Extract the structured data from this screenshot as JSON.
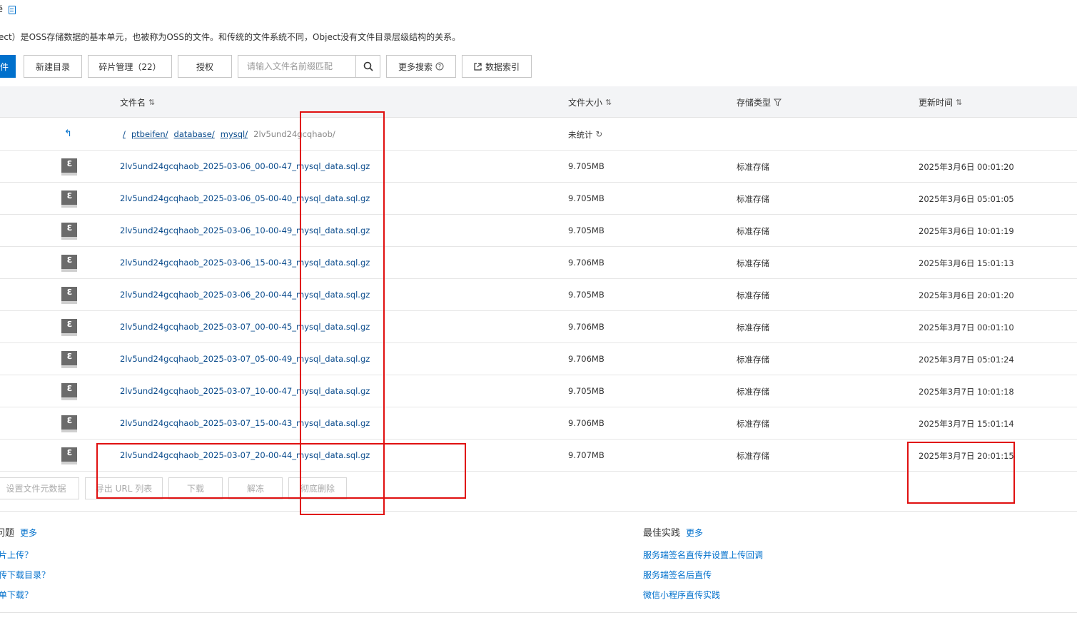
{
  "header": {
    "title": "ë",
    "description": "ect）是OSS存储数据的基本单元，也被称为OSS的文件。和传统的文件系统不同，Object没有文件目录层级结构的关系。"
  },
  "toolbar": {
    "upload_label": "件",
    "new_dir_label": "新建目录",
    "fragments_label": "碎片管理（22）",
    "authorize_label": "授权",
    "search_placeholder": "请输入文件名前缀匹配",
    "more_search_label": "更多搜索",
    "data_index_label": "数据索引"
  },
  "table": {
    "headers": {
      "name": "文件名",
      "size": "文件大小",
      "storage": "存储类型",
      "time": "更新时间"
    },
    "breadcrumb": [
      "/",
      "ptbeifen/",
      "database/",
      "mysql/"
    ],
    "breadcrumb_current": "2lv5und24gcqhaob/",
    "unstat_label": "未统计",
    "rows": [
      {
        "name": "2lv5und24gcqhaob_2025-03-06_00-00-47_mysql_data.sql.gz",
        "size": "9.705MB",
        "type": "标准存储",
        "time": "2025年3月6日 00:01:20"
      },
      {
        "name": "2lv5und24gcqhaob_2025-03-06_05-00-40_mysql_data.sql.gz",
        "size": "9.705MB",
        "type": "标准存储",
        "time": "2025年3月6日 05:01:05"
      },
      {
        "name": "2lv5und24gcqhaob_2025-03-06_10-00-49_mysql_data.sql.gz",
        "size": "9.705MB",
        "type": "标准存储",
        "time": "2025年3月6日 10:01:19"
      },
      {
        "name": "2lv5und24gcqhaob_2025-03-06_15-00-43_mysql_data.sql.gz",
        "size": "9.706MB",
        "type": "标准存储",
        "time": "2025年3月6日 15:01:13"
      },
      {
        "name": "2lv5und24gcqhaob_2025-03-06_20-00-44_mysql_data.sql.gz",
        "size": "9.705MB",
        "type": "标准存储",
        "time": "2025年3月6日 20:01:20"
      },
      {
        "name": "2lv5und24gcqhaob_2025-03-07_00-00-45_mysql_data.sql.gz",
        "size": "9.706MB",
        "type": "标准存储",
        "time": "2025年3月7日 00:01:10"
      },
      {
        "name": "2lv5und24gcqhaob_2025-03-07_05-00-49_mysql_data.sql.gz",
        "size": "9.706MB",
        "type": "标准存储",
        "time": "2025年3月7日 05:01:24"
      },
      {
        "name": "2lv5und24gcqhaob_2025-03-07_10-00-47_mysql_data.sql.gz",
        "size": "9.705MB",
        "type": "标准存储",
        "time": "2025年3月7日 10:01:18"
      },
      {
        "name": "2lv5und24gcqhaob_2025-03-07_15-00-43_mysql_data.sql.gz",
        "size": "9.706MB",
        "type": "标准存储",
        "time": "2025年3月7日 15:01:14"
      },
      {
        "name": "2lv5und24gcqhaob_2025-03-07_20-00-44_mysql_data.sql.gz",
        "size": "9.707MB",
        "type": "标准存储",
        "time": "2025年3月7日 20:01:15"
      }
    ]
  },
  "bulk_actions": {
    "set_meta": "设置文件元数据",
    "export_url": "导出 URL 列表",
    "download": "下载",
    "unfreeze": "解冻",
    "delete": "彻底删除"
  },
  "faq": {
    "title": "问题",
    "more": "更多",
    "links": [
      "片上传？",
      "传下载目录？",
      "单下载？"
    ]
  },
  "best_practice": {
    "title": "最佳实践",
    "more": "更多",
    "links": [
      "服务端签名直传并设置上传回调",
      "服务端签名后直传",
      "微信小程序直传实践"
    ]
  }
}
